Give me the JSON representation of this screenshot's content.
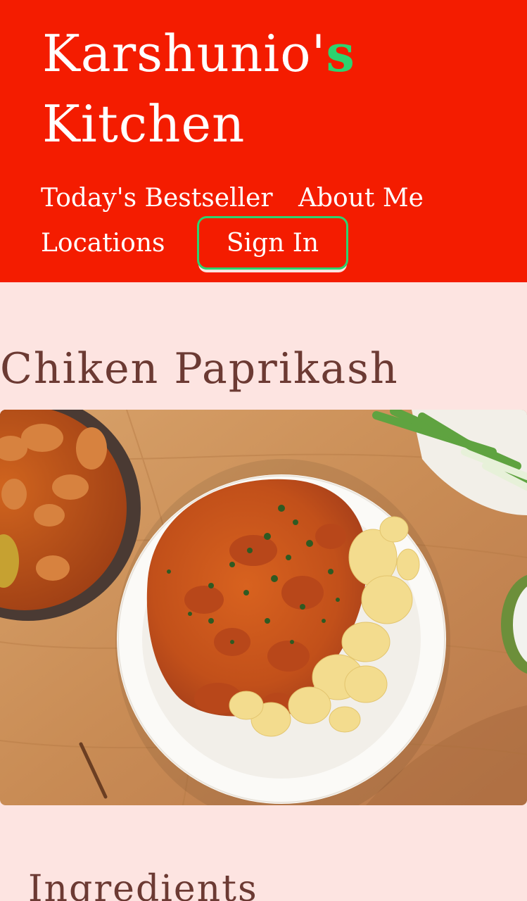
{
  "header": {
    "brand_main": "Karshunio'",
    "brand_accent": "s",
    "brand_line2": "Kitchen",
    "nav": {
      "bestseller": "Today's Bestseller",
      "about": "About Me",
      "locations": "Locations",
      "sign_in": "Sign In"
    }
  },
  "recipe": {
    "title": "Chiken Paprikash",
    "image_icon": "food-photo"
  },
  "sections": {
    "ingredients_heading": "Ingredients"
  },
  "colors": {
    "header_bg": "#f41c00",
    "accent_green": "#2dd36f",
    "page_bg": "#fde4e1",
    "heading_text": "#6c3a33"
  }
}
